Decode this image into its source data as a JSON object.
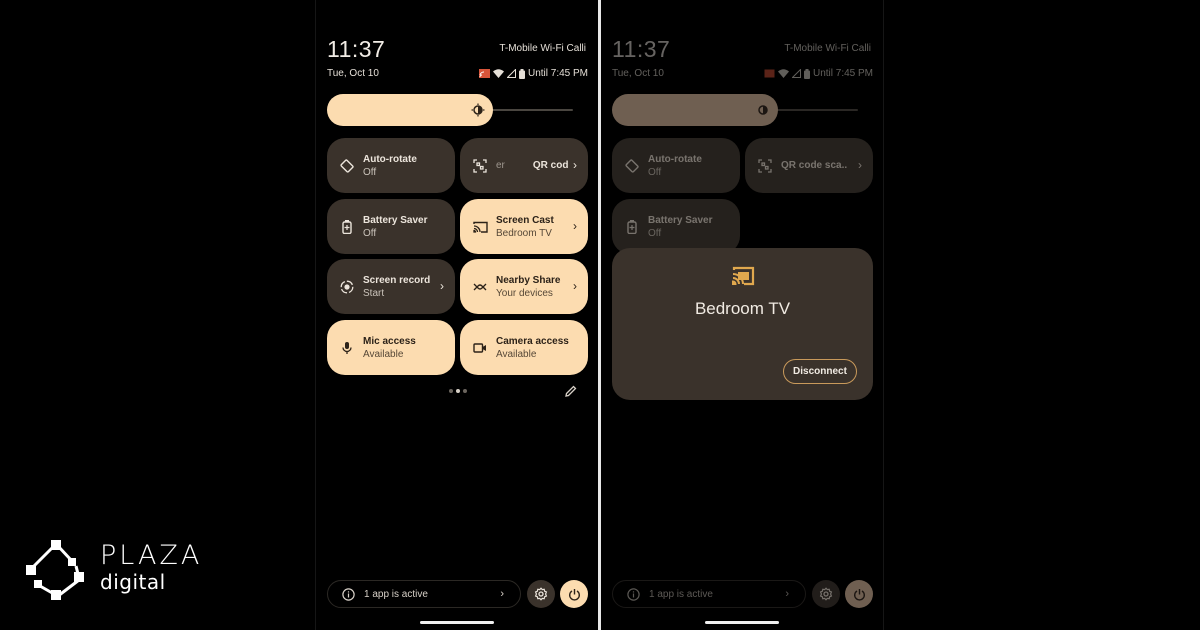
{
  "left_screen": {
    "clock": "11:37",
    "date": "Tue, Oct 10",
    "carrier": "T-Mobile Wi-Fi Calli",
    "battery_status": "Until 7:45 PM",
    "status_icons": [
      "cast-icon",
      "wifi-icon",
      "signal-icon",
      "battery-icon"
    ],
    "brightness_level": 0.68,
    "tiles": [
      {
        "label": "Auto-rotate",
        "sublabel": "Off",
        "state": "off",
        "icon": "auto-rotate-icon"
      },
      {
        "label": "QR cod",
        "sublabel": "er",
        "state": "off",
        "icon": "qr-scanner-icon",
        "has_chevron": true
      },
      {
        "label": "Battery Saver",
        "sublabel": "Off",
        "state": "off",
        "icon": "battery-saver-icon"
      },
      {
        "label": "Screen Cast",
        "sublabel": "Bedroom TV",
        "state": "on",
        "icon": "cast-icon",
        "has_chevron": true
      },
      {
        "label": "Screen record",
        "sublabel": "Start",
        "state": "off",
        "icon": "screen-record-icon",
        "has_chevron": true
      },
      {
        "label": "Nearby Share",
        "sublabel": "Your devices",
        "state": "on",
        "icon": "nearby-share-icon",
        "has_chevron": true
      },
      {
        "label": "Mic access",
        "sublabel": "Available",
        "state": "on",
        "icon": "mic-icon"
      },
      {
        "label": "Camera access",
        "sublabel": "Available",
        "state": "on",
        "icon": "camera-icon"
      }
    ],
    "page_indicator": {
      "pages": 3,
      "current": 2
    },
    "footer": {
      "active_apps": "1 app is active"
    }
  },
  "right_screen": {
    "clock": "11:37",
    "date": "Tue, Oct 10",
    "carrier": "T-Mobile Wi-Fi Calli",
    "battery_status": "Until 7:45 PM",
    "brightness_level": 0.68,
    "tiles": [
      {
        "label": "Auto-rotate",
        "sublabel": "Off",
        "state": "off",
        "icon": "auto-rotate-icon"
      },
      {
        "label": "QR code sca..",
        "state": "off",
        "icon": "qr-scanner-icon",
        "has_chevron": true
      },
      {
        "label": "Battery Saver",
        "sublabel": "Off",
        "state": "off",
        "icon": "battery-saver-icon"
      }
    ],
    "cast_dialog": {
      "device_name": "Bedroom TV",
      "disconnect_label": "Disconnect"
    },
    "footer": {
      "active_apps": "1 app is active"
    }
  },
  "logo": {
    "line1": "PLAZA",
    "line2": "digital"
  },
  "colors": {
    "tile_on": "#fcdcb0",
    "tile_off": "#3a322b",
    "accent_outline": "#c99a5b",
    "background": "#000000"
  }
}
